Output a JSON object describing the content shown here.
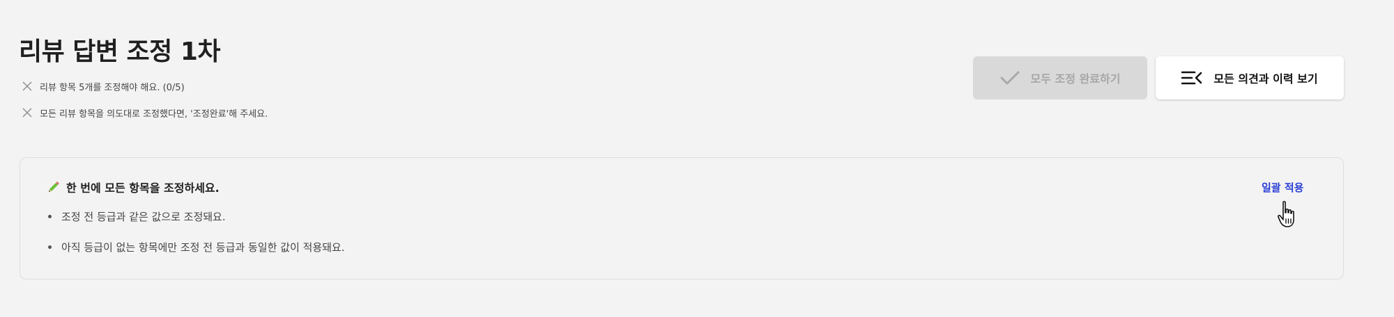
{
  "page": {
    "title": "리뷰 답변 조정 1차"
  },
  "checklist": [
    {
      "icon": "close-icon",
      "text": "리뷰 항목 5개를 조정해야 해요. (0/5)"
    },
    {
      "icon": "close-icon",
      "text": "모든 리뷰 항목을 의도대로 조정했다면, '조정완료'해 주세요."
    }
  ],
  "actions": {
    "complete_label": "모두 조정 완료하기",
    "complete_icon": "check-icon",
    "complete_disabled": true,
    "history_label": "모든 의견과 이력 보기",
    "history_icon": "menu-collapse-icon"
  },
  "bulk_panel": {
    "icon": "pencil-icon",
    "heading": "한 번에 모든 항목을 조정하세요.",
    "bullets": [
      "조정 전 등급과 같은 값으로 조정돼요.",
      "아직 등급이 없는 항목에만 조정 전 등급과 동일한 값이 적용돼요."
    ],
    "apply_label": "일괄 적용"
  },
  "colors": {
    "background": "#f3f3f3",
    "link": "#2b3fd6",
    "disabled_button": "#d9d9d9",
    "disabled_text": "#a6a6a6",
    "pencil": "#6fbf3a"
  }
}
